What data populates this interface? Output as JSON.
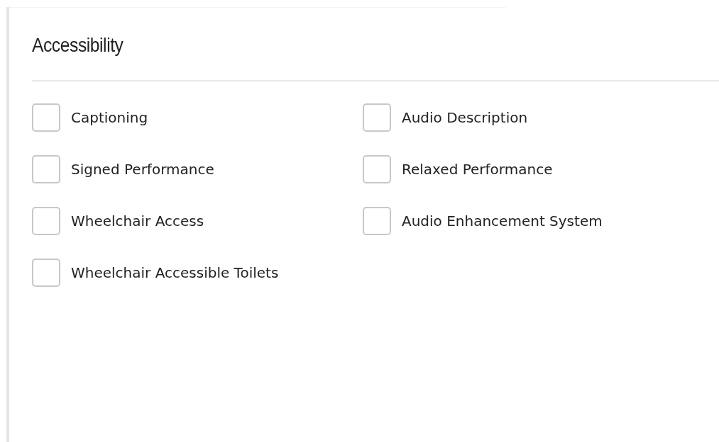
{
  "dialog": {
    "title": "Accessibility"
  },
  "options": [
    {
      "label": "Captioning",
      "checked": false
    },
    {
      "label": "Audio Description",
      "checked": false
    },
    {
      "label": "Signed Performance",
      "checked": false
    },
    {
      "label": "Relaxed Performance",
      "checked": false
    },
    {
      "label": "Wheelchair Access",
      "checked": false
    },
    {
      "label": "Audio Enhancement System",
      "checked": false
    },
    {
      "label": "Wheelchair Accessible Toilets",
      "checked": false
    }
  ]
}
